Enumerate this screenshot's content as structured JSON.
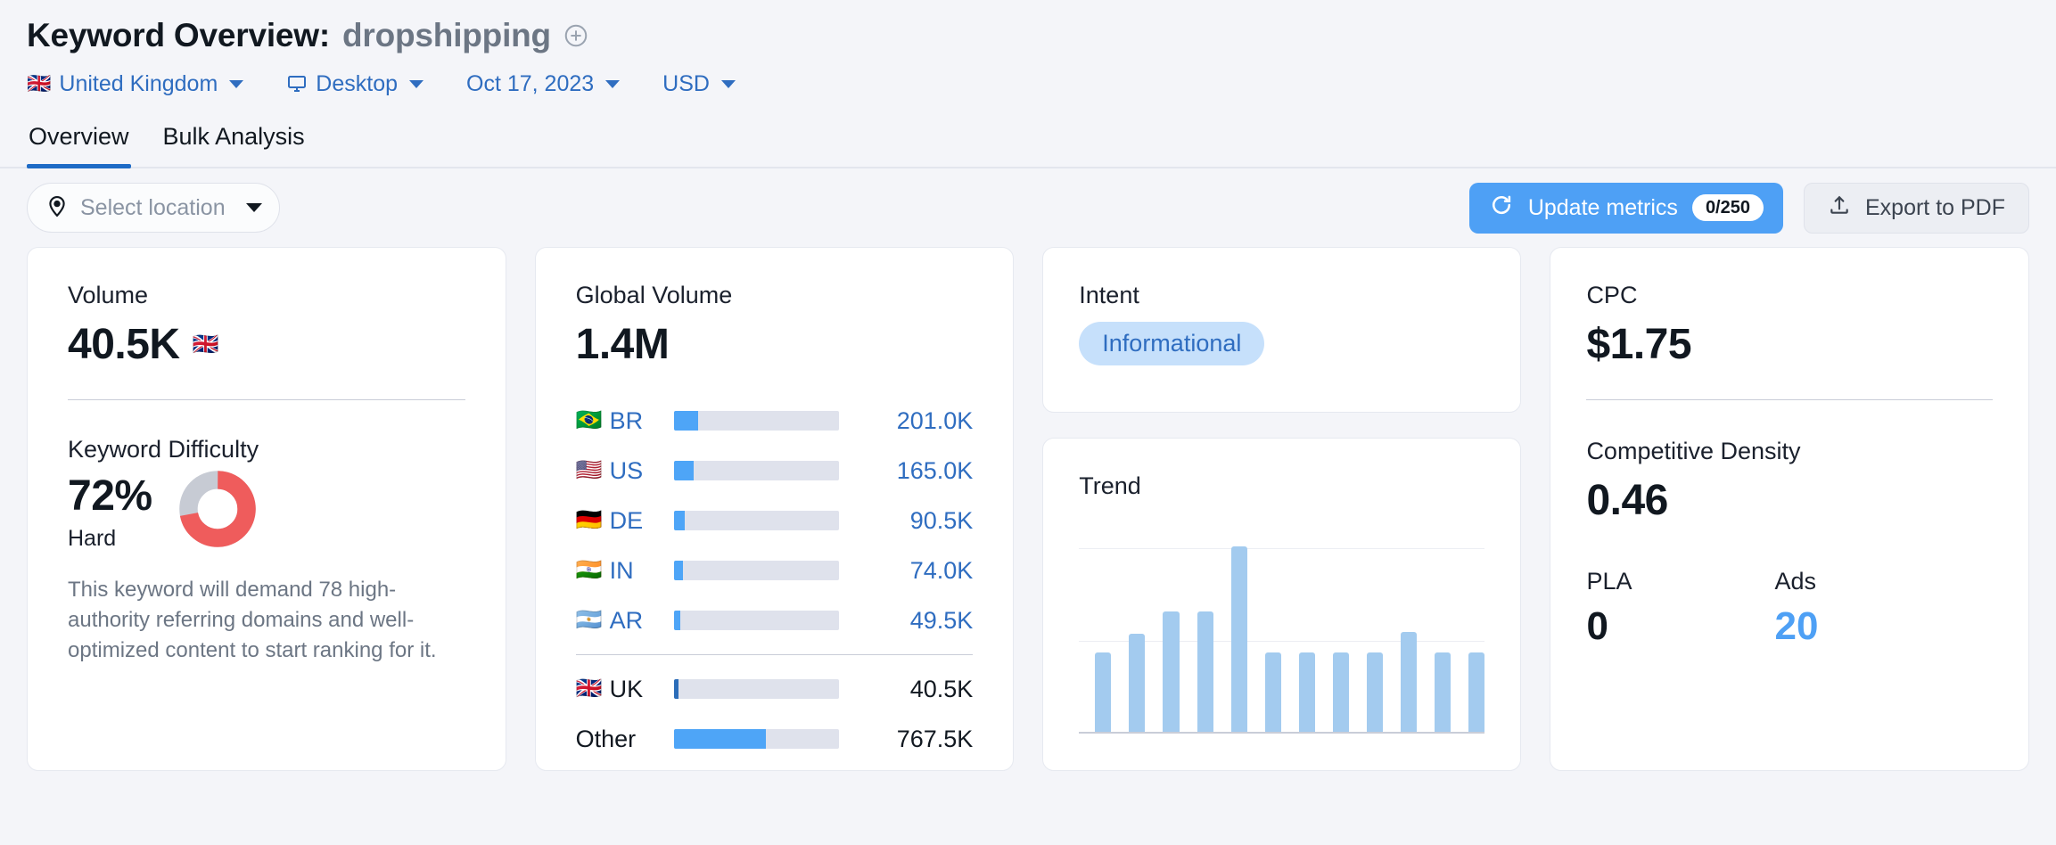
{
  "header": {
    "title_prefix": "Keyword Overview:",
    "keyword": "dropshipping",
    "add_icon": "plus-circle-icon",
    "filters": [
      {
        "label": "United Kingdom",
        "icon": "uk-flag-icon",
        "flag": "🇬🇧"
      },
      {
        "label": "Desktop",
        "icon": "monitor-icon",
        "flag": ""
      },
      {
        "label": "Oct 17, 2023",
        "icon": "",
        "flag": ""
      },
      {
        "label": "USD",
        "icon": "",
        "flag": ""
      }
    ]
  },
  "tabs": [
    {
      "label": "Overview",
      "active": true
    },
    {
      "label": "Bulk Analysis",
      "active": false
    }
  ],
  "toolbar": {
    "location_placeholder": "Select location",
    "location_icon": "map-pin-icon",
    "update_label": "Update metrics",
    "update_icon": "refresh-icon",
    "update_badge": "0/250",
    "export_label": "Export to PDF",
    "export_icon": "upload-icon"
  },
  "volume_card": {
    "label": "Volume",
    "value": "40.5K",
    "flag": "🇬🇧",
    "difficulty_label": "Keyword Difficulty",
    "difficulty_value": "72%",
    "difficulty_word": "Hard",
    "difficulty_note": "This keyword will demand 78 high-authority referring domains and well-optimized content to start ranking for it.",
    "donut_color": "#ef5c5c",
    "donut_track": "#c7cbd4"
  },
  "global_card": {
    "label": "Global Volume",
    "value": "1.4M",
    "rows": [
      {
        "flag": "🇧🇷",
        "code": "BR",
        "value": "201.0K",
        "pct": 14.7,
        "highlight": false
      },
      {
        "flag": "🇺🇸",
        "code": "US",
        "value": "165.0K",
        "pct": 11.8,
        "highlight": false
      },
      {
        "flag": "🇩🇪",
        "code": "DE",
        "value": "90.5K",
        "pct": 6.6,
        "highlight": false
      },
      {
        "flag": "🇮🇳",
        "code": "IN",
        "value": "74.0K",
        "pct": 5.4,
        "highlight": false
      },
      {
        "flag": "🇦🇷",
        "code": "AR",
        "value": "49.5K",
        "pct": 3.9,
        "highlight": false
      }
    ],
    "rows_other": [
      {
        "flag": "🇬🇧",
        "code": "UK",
        "value": "40.5K",
        "pct": 2.7,
        "highlight": true
      },
      {
        "flag": "",
        "code": "Other",
        "value": "767.5K",
        "pct": 55.5,
        "highlight": false
      }
    ]
  },
  "intent_card": {
    "label": "Intent",
    "chip": "Informational"
  },
  "trend_card": {
    "label": "Trend"
  },
  "cpc_card": {
    "label": "CPC",
    "value": "$1.75",
    "density_label": "Competitive Density",
    "density_value": "0.46",
    "pla_label": "PLA",
    "pla_value": "0",
    "ads_label": "Ads",
    "ads_value": "20"
  },
  "chart_data": {
    "type": "bar",
    "title": "Trend",
    "xlabel": "",
    "ylabel": "",
    "categories": [
      "1",
      "2",
      "3",
      "4",
      "5",
      "6",
      "7",
      "8",
      "9",
      "10",
      "11",
      "12"
    ],
    "values": [
      43,
      53,
      65,
      65,
      100,
      43,
      43,
      43,
      43,
      54,
      43,
      43
    ],
    "ylim": [
      0,
      100
    ],
    "grid": true,
    "gridlines": [
      50,
      100
    ],
    "legend": "none",
    "bar_color": "#a3cbef"
  }
}
